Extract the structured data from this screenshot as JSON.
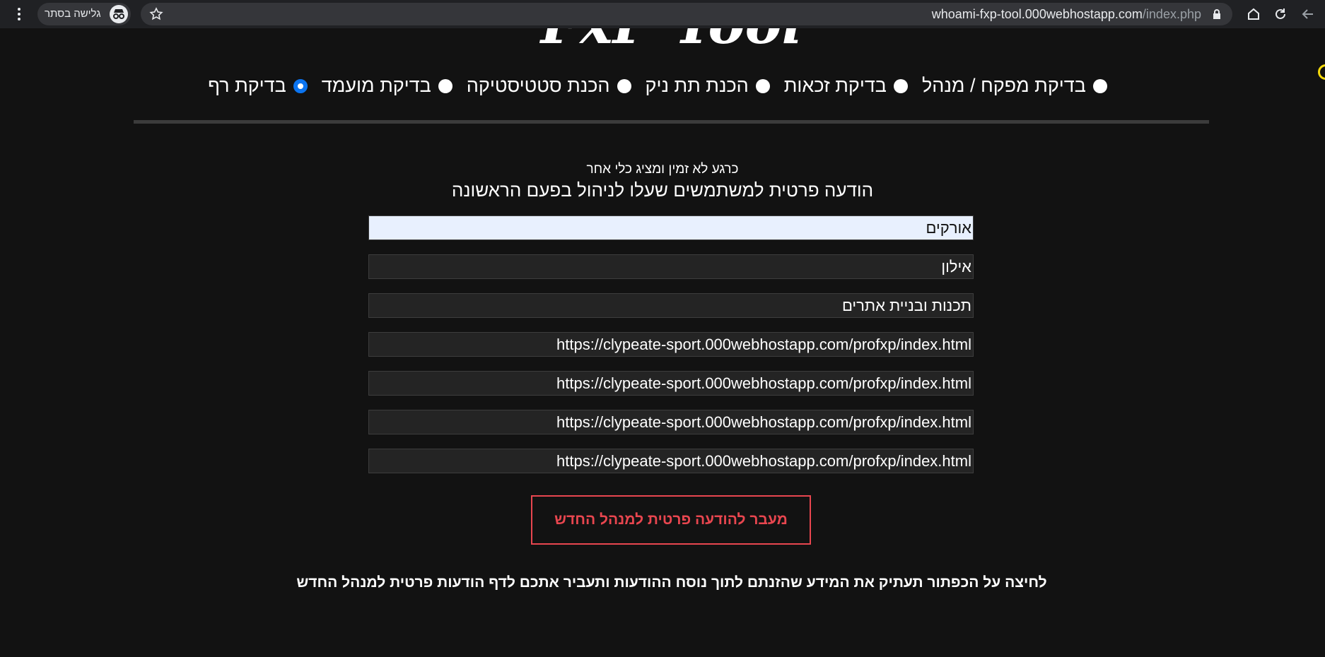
{
  "browser": {
    "url_host": "whoami-fxp-tool.000webhostapp.com",
    "url_path": "/index.php",
    "incognito_label": "גלישה בסתר"
  },
  "header": {
    "logo_text": "FxP Tool"
  },
  "tool_options": [
    {
      "label": "בדיקת מפקח / מנהל",
      "checked": false
    },
    {
      "label": "בדיקת זכאות",
      "checked": false
    },
    {
      "label": "הכנת תת ניק",
      "checked": false
    },
    {
      "label": "הכנת סטטיסטיקה",
      "checked": false
    },
    {
      "label": "בדיקת מועמד",
      "checked": false
    },
    {
      "label": "בדיקת רף",
      "checked": true
    }
  ],
  "form": {
    "notice": "כרגע לא זמין ומציג כלי אחר",
    "title": "הודעה פרטית למשתמשים שעלו לניהול בפעם הראשונה",
    "fields": [
      "אורקים",
      "אילון",
      "תכנות ובניית אתרים",
      "https://clypeate-sport.000webhostapp.com/profxp/index.html",
      "https://clypeate-sport.000webhostapp.com/profxp/index.html",
      "https://clypeate-sport.000webhostapp.com/profxp/index.html",
      "https://clypeate-sport.000webhostapp.com/profxp/index.html"
    ],
    "submit_label": "מעבר להודעה פרטית למנהל החדש",
    "footnote": "לחיצה על הכפתור תעתיק את המידע שהזנתם לתוך נוסח ההודעות ותעביר אתכם לדף הודעות פרטית למנהל החדש"
  },
  "colors": {
    "background": "#121212",
    "accent": "#e8464f",
    "radio_checked": "#0b74f0",
    "autofill": "#e8f0fe"
  }
}
